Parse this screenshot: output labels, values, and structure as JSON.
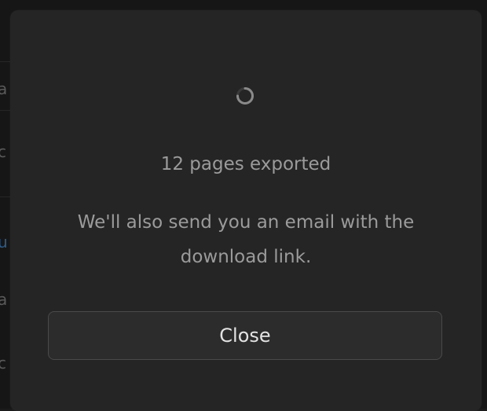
{
  "background": {
    "edge_chars": [
      {
        "char": "a",
        "link": false
      },
      {
        "char": "c",
        "link": false
      },
      {
        "char": "u",
        "link": true
      },
      {
        "char": "a",
        "link": false
      },
      {
        "char": "c",
        "link": false
      }
    ]
  },
  "modal": {
    "spinner_icon": "loading-spinner-icon",
    "count_text": "12 pages exported",
    "info_text": "We'll also send you an email with the download link.",
    "close_label": "Close"
  },
  "colors": {
    "modal_bg": "#252525",
    "text_muted": "#9b9b9b",
    "button_bg": "#2c2c2c",
    "button_border": "#4a4a4a",
    "link_blue": "#2f5b86"
  }
}
